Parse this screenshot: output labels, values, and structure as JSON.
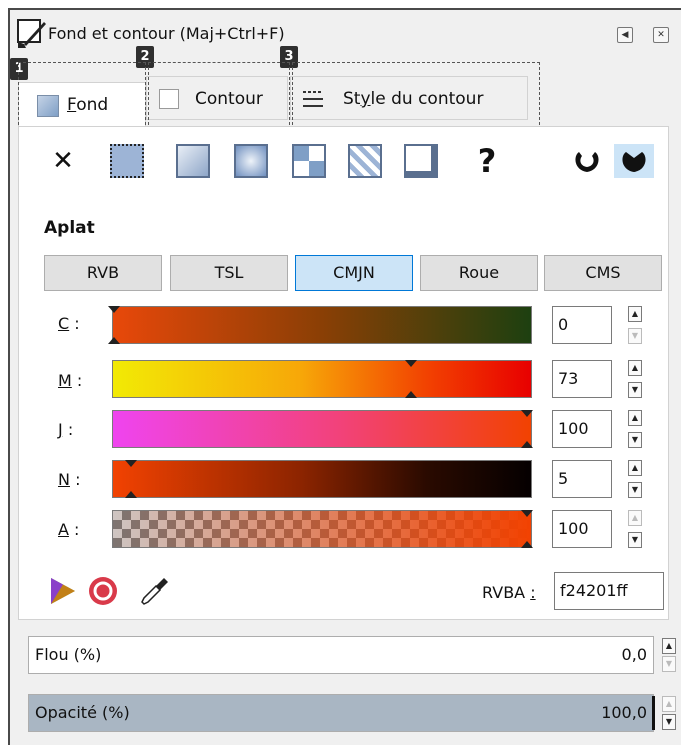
{
  "dialog": {
    "title": "Fond et contour (Maj+Ctrl+F)"
  },
  "badges": [
    "1",
    "2",
    "3"
  ],
  "tabs": [
    {
      "label": "Fond",
      "mnemonic": "F",
      "rest": "ond"
    },
    {
      "label": "Contour"
    },
    {
      "label": "Style du contour",
      "pre": "St",
      "mnemonic": "y",
      "rest": "le du contour"
    }
  ],
  "fill_types": [
    "no-paint",
    "flat-color",
    "linear-gradient",
    "radial-gradient",
    "mesh-gradient",
    "pattern",
    "swatch",
    "unset"
  ],
  "fill_rules": [
    "evenodd",
    "nonzero"
  ],
  "section_label": "Aplat",
  "color_modes": [
    "RVB",
    "TSL",
    "CMJN",
    "Roue",
    "CMS"
  ],
  "active_mode": "CMJN",
  "channels": [
    {
      "letter": "C",
      "sep": ":",
      "value": "0"
    },
    {
      "letter": "M",
      "sep": ":",
      "value": "73"
    },
    {
      "letter": "J",
      "sep": ":",
      "value": "100"
    },
    {
      "letter": "N",
      "sep": ":",
      "value": "5"
    },
    {
      "letter": "A",
      "sep": ":",
      "value": "100"
    }
  ],
  "rgba": {
    "label": "RVBA",
    "sep": ":",
    "value": "f24201ff"
  },
  "blur": {
    "label": "Flou (%)",
    "value": "0,0"
  },
  "opacity": {
    "label": "Opacité (%)",
    "value": "100,0"
  },
  "colors": {
    "current": "#f24201",
    "accent": "#0078d7"
  }
}
